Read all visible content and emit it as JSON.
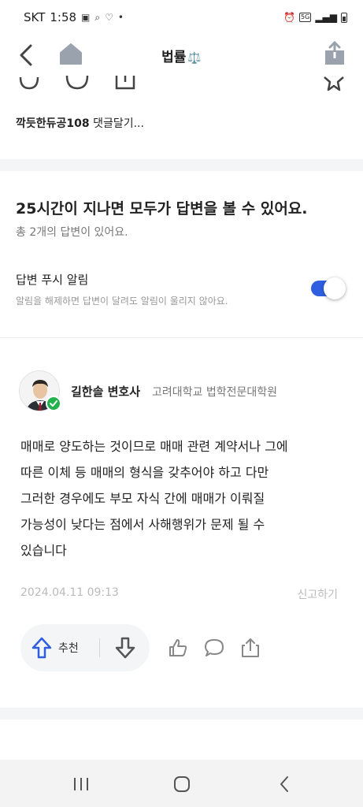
{
  "status_bar": {
    "carrier": "SKT",
    "time": "1:58",
    "network": "5G"
  },
  "header": {
    "title": "법률",
    "title_emoji": "⚖️"
  },
  "comment_prompt": {
    "nickname": "깍듯한듀공108",
    "text": "댓글달기..."
  },
  "answers_section": {
    "heading": "25시간이 지나면 모두가 답변을 볼 수 있어요.",
    "count_text": "총 2개의 답변이 있어요.",
    "push": {
      "title": "답변 푸시 알림",
      "description": "알림을 해제하면 답변이 달려도 알림이 울리지 않아요.",
      "enabled": true
    }
  },
  "answer": {
    "author_name": "길한솔 변호사",
    "author_affiliation": "고려대학교 법학전문대학원",
    "body_lines": [
      "매매로 양도하는 것이므로 매매 관련 계약서나 그에",
      "따른 이체 등 매매의 형식을 갖추어야 하고 다만",
      "그러한 경우에도 부모 자식 간에 매매가 이뤄질",
      "가능성이 낮다는 점에서 사해행위가 문제 될 수",
      "있습니다"
    ],
    "date": "2024.04.11 09:13",
    "report_label": "신고하기",
    "upvote_label": "추천"
  },
  "colors": {
    "accent": "#2f5fe0",
    "verified": "#22b14c",
    "muted": "#999999"
  }
}
